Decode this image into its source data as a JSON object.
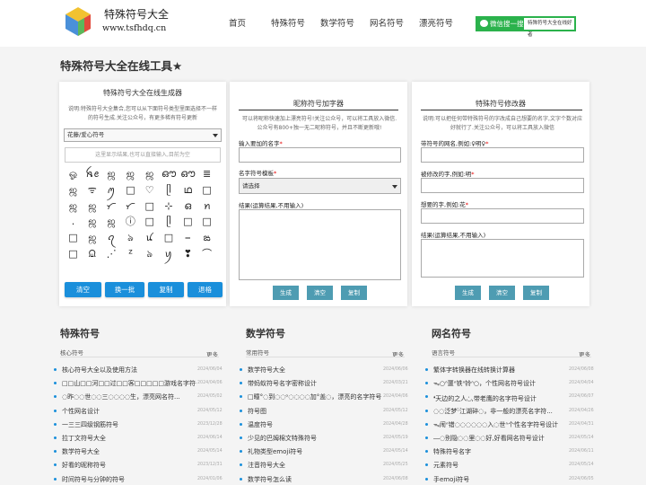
{
  "header": {
    "site_title": "特殊符号大全",
    "site_url": "www.tsfhdq.cn",
    "nav": [
      "首页",
      "特殊符号",
      "数学符号",
      "网名符号",
      "漂亮符号"
    ],
    "wechat_button": "微信搜一搜",
    "wechat_search_text": "特殊符号大全在线好者"
  },
  "page_title": "特殊符号大全在线工具★",
  "generator": {
    "title": "特殊符号大全在线生成器",
    "desc": "说明:特殊符号大全集合,您可以从下面符号类型里面选择不一样的符号生成.关注公众号，有更多稀有符号更新",
    "select_value": "花藤/爱心符号",
    "display_placeholder": "这里显示结果,也可以直接输入,目前为空",
    "symbols": [
      "ஓ",
      "ꫝꫀ",
      "ஜ",
      "ஜ",
      "ஜ",
      "ഔ",
      "ഔ",
      "≣",
      "ஜ",
      "ᯤ",
      "ꪑ",
      "□",
      "♡",
      "ᥫ",
      "ഥ",
      "□",
      "ஜ",
      "ஜ",
      "ᜆ",
      "ᜆ",
      "□",
      "⊹",
      "ഒ",
      "ꪀ",
      ".",
      "ஜ",
      "ஜ",
      "ⓘ",
      "□",
      "ᥫ",
      "□",
      "□",
      "□",
      "ஜ",
      "ꪖ",
      "ঌ",
      "ꪙ",
      "□",
      "⎯",
      "ఙ",
      "□",
      "ᙉ",
      "⋰",
      "ᙆ",
      "ঌ",
      "ꪗ",
      "❣",
      "⌒"
    ],
    "buttons": [
      "清空",
      "换一批",
      "复制",
      "退格"
    ]
  },
  "nickname_tool": {
    "title": "昵称符号加字器",
    "desc": "可以将昵称快速加上漂亮符号!关注公众号，可以将工具放入微信.公众号有800+独一无二昵称符号，并且不断更新哦!",
    "label_name": "输入要加的名字",
    "label_template": "名字符号模板",
    "select_value": "请选择",
    "label_result": "结果(运算结果,不用输入)",
    "buttons": [
      "生成",
      "清空",
      "复制"
    ]
  },
  "modifier_tool": {
    "title": "特殊符号修改器",
    "desc": "说明:可以把任何带特殊符号的字改成自己想要的名字,文字个数对应好就行了.关注公众号，可以将工具放入微信",
    "label_symbol_name": "带符号的网名,例如:♀明♀",
    "label_modify": "被修改的字,例如:明",
    "label_want": "想要的字,例如:花",
    "label_result": "结果(运算结果,不用输入)",
    "buttons": [
      "生成",
      "清空",
      "复制"
    ]
  },
  "sections": [
    {
      "title": "特殊符号",
      "subtitle": "核心符号",
      "more": "更多",
      "items": [
        {
          "text": "核心符号大全以及使用方法",
          "date": "2024/06/04"
        },
        {
          "text": "□□山□□河□□过□□客□□□□□游戏名字符号",
          "date": "2024/04/06"
        },
        {
          "text": "◌昨◌◌世◌◌三◌◌◌◌生，漂亮网名符...",
          "date": "2024/05/02"
        },
        {
          "text": "个性网名设计",
          "date": "2024/05/12"
        },
        {
          "text": "一三三四级钢筋符号",
          "date": "2023/12/28"
        },
        {
          "text": "拉丁文符号大全",
          "date": "2024/06/14"
        },
        {
          "text": "数学符号大全",
          "date": "2024/05/14"
        },
        {
          "text": "好看的昵称符号",
          "date": "2023/12/31"
        },
        {
          "text": "时间符号与分钟的符号",
          "date": "2024/01/06"
        }
      ]
    },
    {
      "title": "数学符号",
      "subtitle": "常用符号",
      "more": "更多",
      "items": [
        {
          "text": "数学符号大全",
          "date": "2024/06/06"
        },
        {
          "text": "带蚂蚁符号名字密称设计",
          "date": "2024/03/21"
        },
        {
          "text": "□瞳°◌到◌◌ᵒ◌◌◌◌加°盖◌，漂亮的名字符号",
          "date": "2024/04/06"
        },
        {
          "text": "符号图",
          "date": "2024/05/12"
        },
        {
          "text": "温度符号",
          "date": "2024/04/28"
        },
        {
          "text": "少见的巴姆棉文特殊符号",
          "date": "2024/05/19"
        },
        {
          "text": "礼物类型emoji符号",
          "date": "2024/05/14"
        },
        {
          "text": "注音符号大全",
          "date": "2024/05/25"
        },
        {
          "text": "数学符号怎么读",
          "date": "2024/06/08"
        }
      ]
    },
    {
      "title": "网名符号",
      "subtitle": "语言符号",
      "more": "更多",
      "items": [
        {
          "text": "繁体字转换器在线转换计算器",
          "date": "2024/06/08"
        },
        {
          "text": "ᯓ○ᐢ噩ᐢ铁ᐢ铃ᐢ○，个性网名符号设计",
          "date": "2024/04/04"
        },
        {
          "text": "❛ᡃ天边的之人◟ᡃ◞,带老鹰的名字符号设计",
          "date": "2024/06/07"
        },
        {
          "text": "◌◌泛梦ᵕ̈江湖碎◌，非一般的漂亮名字符...",
          "date": "2024/04/26"
        },
        {
          "text": "ᯓ闹ᐢ错◌◌◌◌◌◌入◌世ᐢ个性名字符号设计",
          "date": "2024/04/31"
        },
        {
          "text": "⎯⎯◌别隐◌◌里◌◌好,好看网名符号设计",
          "date": "2024/05/14"
        },
        {
          "text": "特殊符号名字",
          "date": "2024/06/11"
        },
        {
          "text": "元素符号",
          "date": "2024/05/14"
        },
        {
          "text": "手emoji符号",
          "date": "2024/06/05"
        }
      ]
    }
  ],
  "colors": {
    "accent_blue": "#1a8fdb",
    "teal_button": "#4e9cb2",
    "wechat_green": "#2bb24c",
    "required_red": "#e60000"
  }
}
